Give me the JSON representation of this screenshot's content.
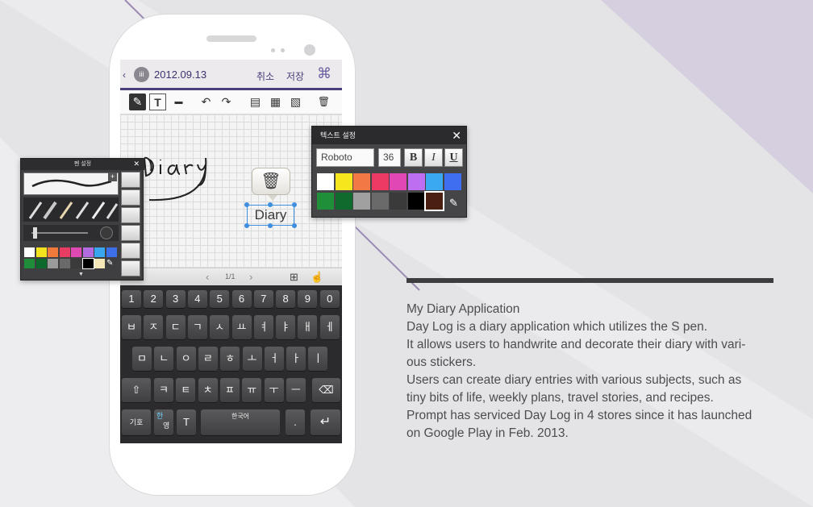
{
  "phone": {
    "status": {
      "back": "‹",
      "calendar": "iii",
      "date": "2012.09.13",
      "cancel": "취소",
      "save": "저장"
    },
    "toolbar": {
      "pen": "✎",
      "text": "T",
      "eraser": "▬",
      "undo": "↶",
      "redo": "↷",
      "template": "▤",
      "date_sticker": "▦",
      "image": "▧",
      "delete": "🗑"
    },
    "canvas": {
      "text_box": "Diary",
      "trash": "🗑"
    },
    "page_bar": {
      "prev": "‹",
      "page": "1/1",
      "next": "›"
    },
    "keyboard": {
      "row1": [
        "1",
        "2",
        "3",
        "4",
        "5",
        "6",
        "7",
        "8",
        "9",
        "0"
      ],
      "row2": [
        "ㅂ",
        "ㅈ",
        "ㄷ",
        "ㄱ",
        "ㅅ",
        "ㅛ",
        "ㅕ",
        "ㅑ",
        "ㅐ",
        "ㅔ"
      ],
      "row3": [
        "ㅁ",
        "ㄴ",
        "ㅇ",
        "ㄹ",
        "ㅎ",
        "ㅗ",
        "ㅓ",
        "ㅏ",
        "ㅣ"
      ],
      "row4": [
        "ㅋ",
        "ㅌ",
        "ㅊ",
        "ㅍ",
        "ㅠ",
        "ㅜ",
        "ㅡ"
      ],
      "shift": "⇧",
      "backspace": "⌫",
      "symbols": "기호",
      "lang_han": "한",
      "lang_eng": "영",
      "handwrite": "T",
      "space": "한국어",
      "period": ".",
      "enter": "↵"
    }
  },
  "pen_panel": {
    "title": "펜 설정",
    "close": "✕",
    "plus": "+",
    "palette": [
      "#ffffff",
      "#f4e21c",
      "#f07a3c",
      "#e83c63",
      "#e049b4",
      "#b36be0",
      "#3aa6f0",
      "#3c6fe8",
      "#1f8d3a",
      "#0e6a2c",
      "#9b9b9b",
      "#6a6a6a",
      "#3a3a3a",
      "#000000",
      "#f4e8b8"
    ]
  },
  "text_panel": {
    "title": "텍스트 설정",
    "close": "✕",
    "font": "Roboto",
    "size": "36",
    "bold": "B",
    "italic": "I",
    "underline": "U",
    "palette": [
      "#ffffff",
      "#f5e61e",
      "#f27845",
      "#ec3a64",
      "#e148b6",
      "#be6ef0",
      "#3ba8f2",
      "#3f6ff0",
      "#1f8f3a",
      "#0f6a2d",
      "#a0a0a0",
      "#6a6a6a",
      "#3a3a3a",
      "#000000",
      "#4a1e10"
    ]
  },
  "description": {
    "title": "My Diary Application",
    "line1": "Day Log is a diary application which utilizes the S pen.",
    "line2": "It allows users to handwrite and decorate their diary with vari-",
    "line3": "ous stickers.",
    "line4": "Users can create diary entries with various subjects, such as",
    "line5": "tiny bits of life, weekly plans, travel stories, and recipes.",
    "line6": "Prompt has serviced Day Log in 4 stores since it has launched",
    "line7": "on Google Play in Feb. 2013."
  },
  "colors": {
    "accent": "#4a3d7a",
    "background": "#e4e4e6",
    "diagonal": "#d6cfe0",
    "selection": "#3e8fe0"
  }
}
